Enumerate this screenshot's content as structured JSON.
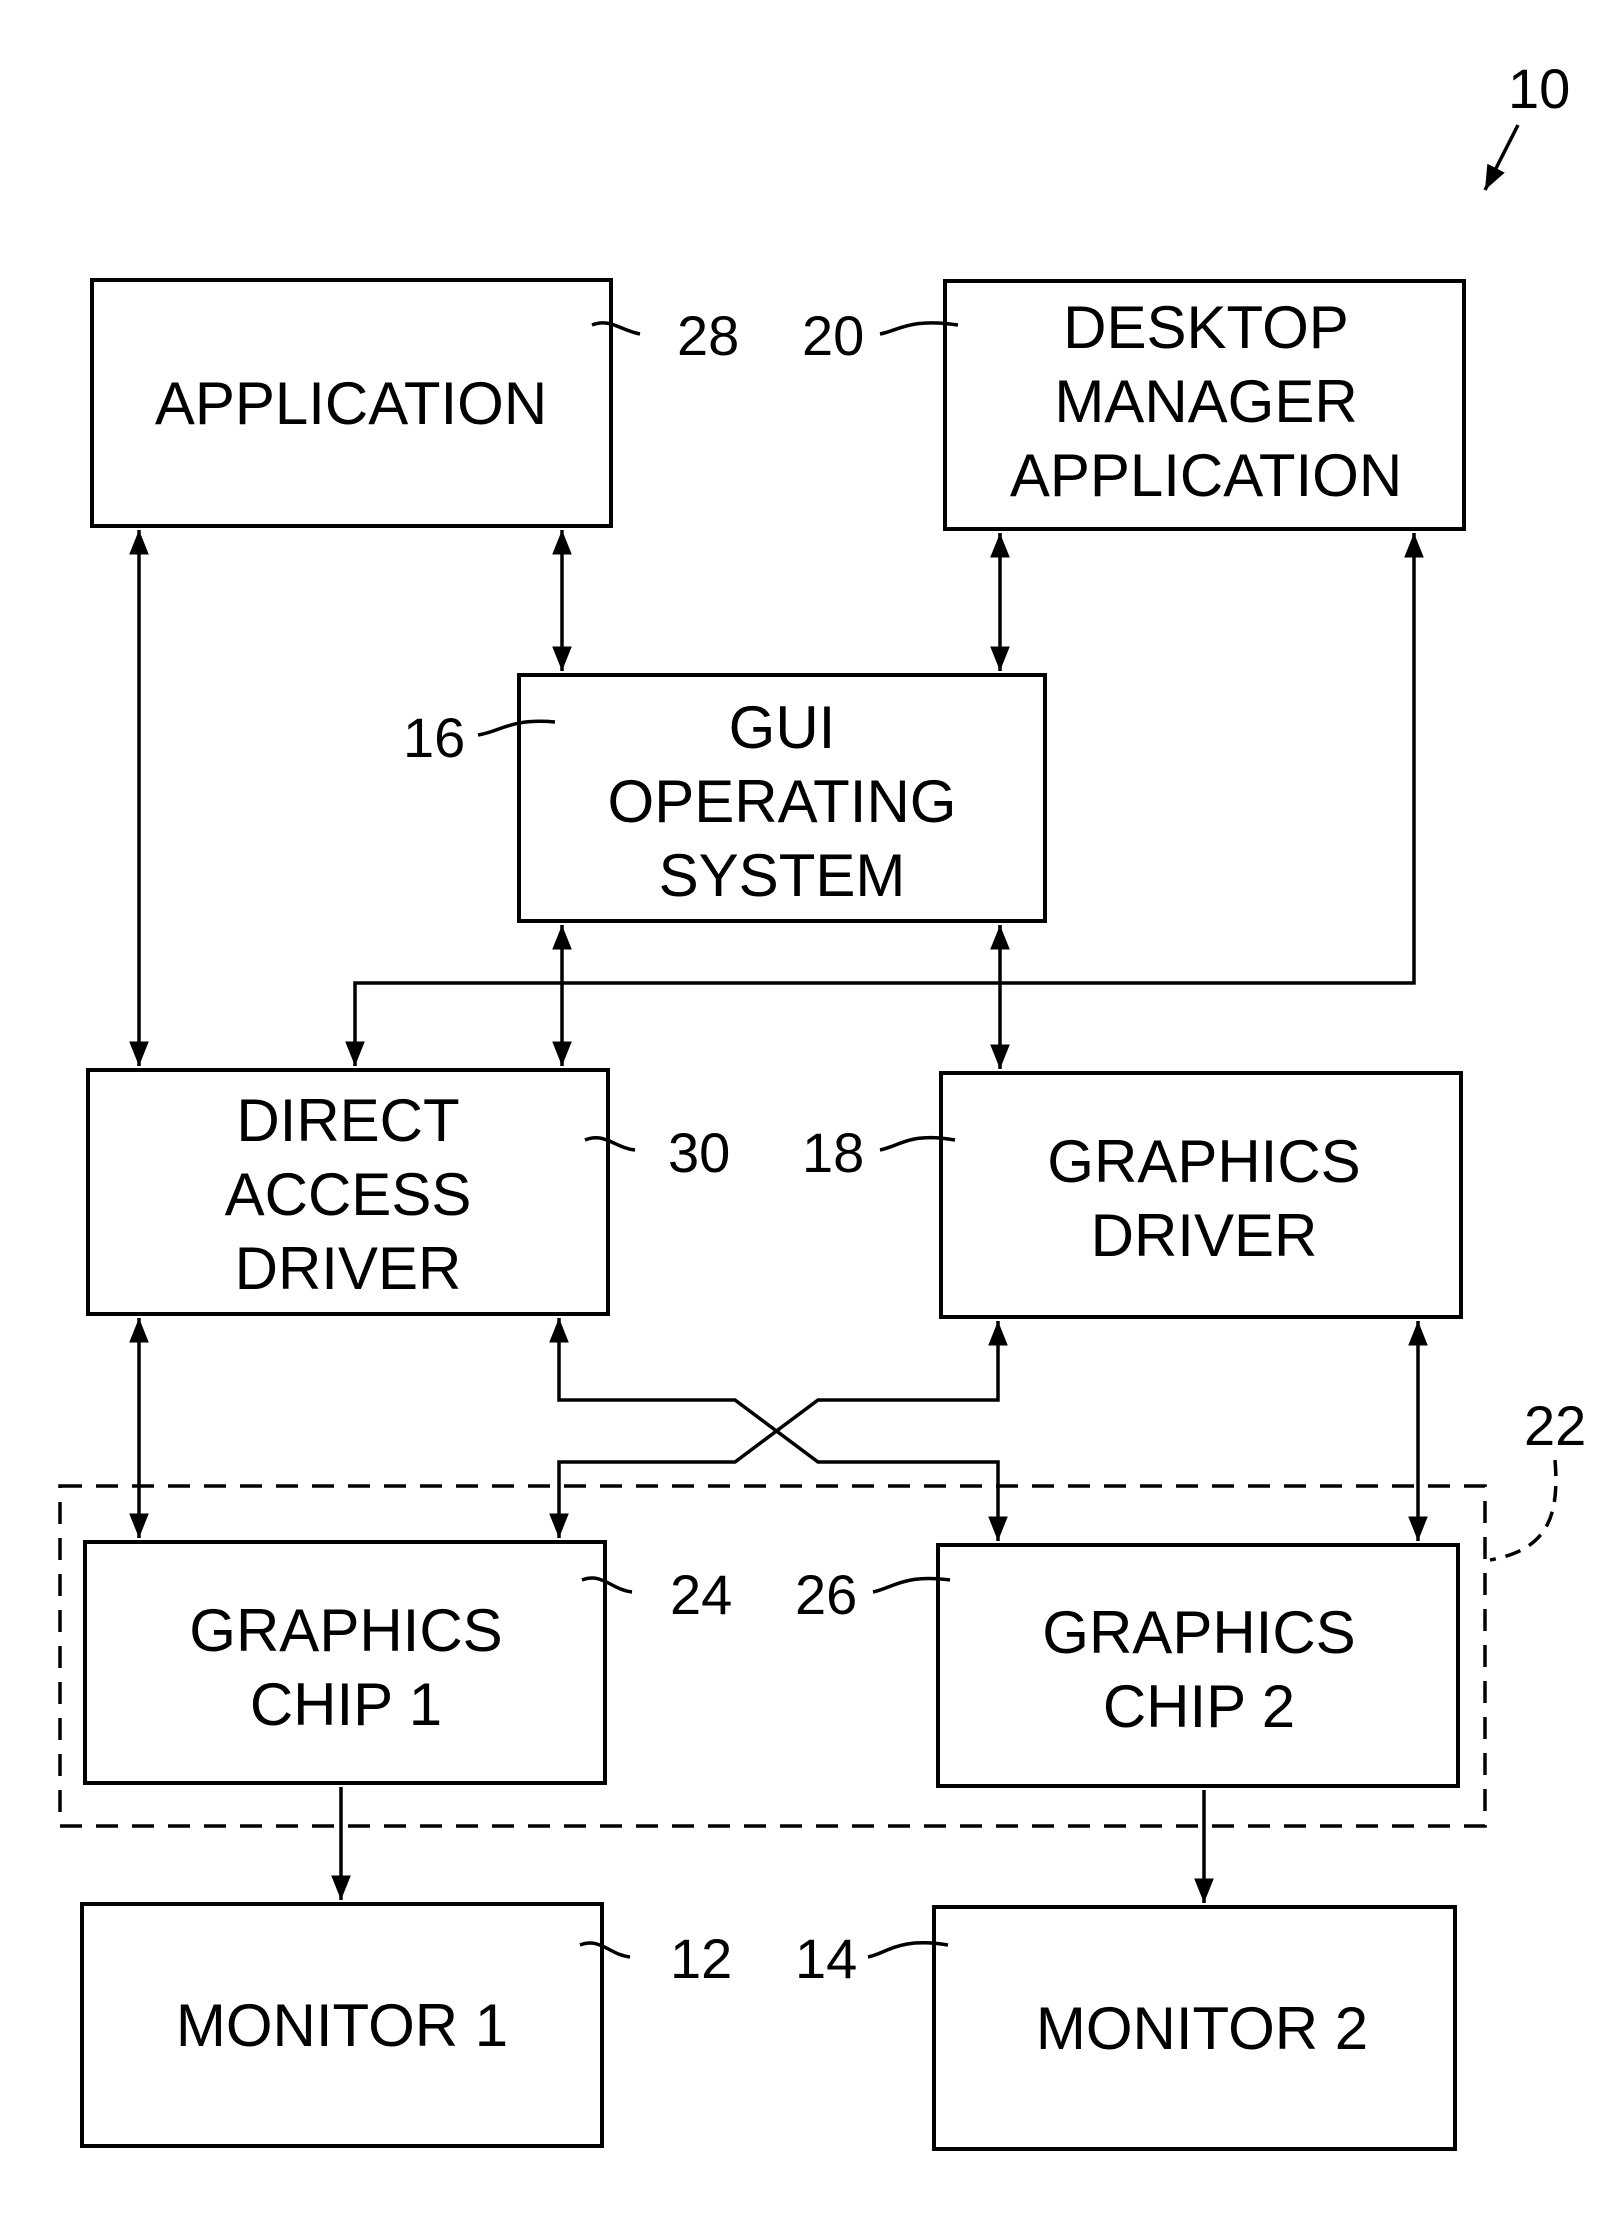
{
  "figure": {
    "ref_label": "10",
    "group_ref_label": "22"
  },
  "blocks": {
    "application": {
      "lines": [
        "APPLICATION"
      ],
      "ref": "28"
    },
    "desktop_manager": {
      "lines": [
        "DESKTOP",
        "MANAGER",
        "APPLICATION"
      ],
      "ref": "20"
    },
    "gui_os": {
      "lines": [
        "GUI",
        "OPERATING",
        "SYSTEM"
      ],
      "ref": "16"
    },
    "direct_access_driver": {
      "lines": [
        "DIRECT",
        "ACCESS",
        "DRIVER"
      ],
      "ref": "30"
    },
    "graphics_driver": {
      "lines": [
        "GRAPHICS",
        "DRIVER"
      ],
      "ref": "18"
    },
    "graphics_chip_1": {
      "lines": [
        "GRAPHICS",
        "CHIP 1"
      ],
      "ref": "24"
    },
    "graphics_chip_2": {
      "lines": [
        "GRAPHICS",
        "CHIP 2"
      ],
      "ref": "26"
    },
    "monitor_1": {
      "lines": [
        "MONITOR 1"
      ],
      "ref": "12"
    },
    "monitor_2": {
      "lines": [
        "MONITOR 2"
      ],
      "ref": "14"
    }
  }
}
